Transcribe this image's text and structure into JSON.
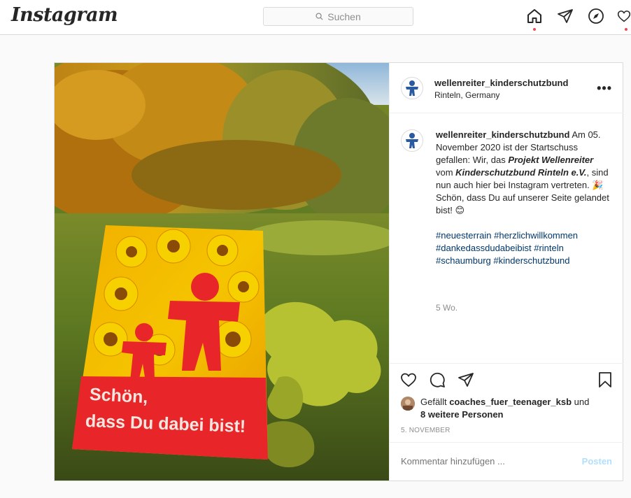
{
  "app": {
    "logo_text": "Instagram"
  },
  "search": {
    "placeholder": "Suchen"
  },
  "post": {
    "author": "wellenreiter_kinderschutzbund",
    "location": "Rinteln, Germany",
    "more_label": "•••",
    "caption": {
      "intro": " Am 05. November 2020 ist der Startschuss gefallen: Wir, das ",
      "bold1": "Projekt Wellenreiter",
      "mid1": " vom ",
      "bold2": "Kinderschutzbund Rinteln e.V.",
      "mid2": ", sind nun auch hier bei Instagram vertreten. ",
      "line2": "Schön, dass Du auf unserer Seite gelandet bist! ",
      "emoji1": "🎉",
      "emoji2": "😊",
      "hashtags": "#neuesterrain #herzlichwillkommen #dankedassdudabeibist #rinteln #schaumburg #kinderschutzbund"
    },
    "time_ago": "5 Wo.",
    "likes": {
      "prefix": "Gefällt ",
      "user": "coaches_fuer_teenager_ksb",
      "mid": " und ",
      "others": "8 weitere Personen"
    },
    "date": "5. NOVEMBER",
    "comment": {
      "placeholder": "Kommentar hinzufügen ...",
      "post_label": "Posten"
    },
    "photo_text": {
      "line1": "Schön,",
      "line2": "dass Du dabei bist!"
    }
  },
  "colors": {
    "accent": "#0095f6",
    "post_disabled": "#b2dffc",
    "hashtag": "#00376b",
    "notify": "#ed4956",
    "card_red": "#e8262a"
  },
  "icons": [
    "search-icon",
    "home-icon",
    "direct-icon",
    "explore-icon",
    "heart-icon",
    "comment-icon",
    "share-icon",
    "bookmark-icon",
    "more-icon"
  ]
}
